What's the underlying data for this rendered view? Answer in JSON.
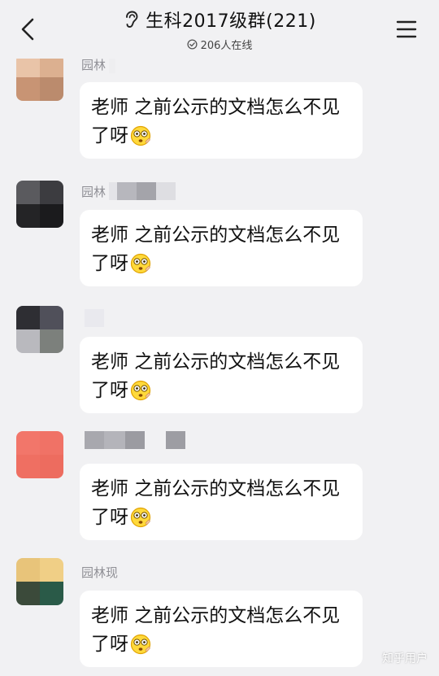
{
  "header": {
    "title": "生科2017级群(221)",
    "online_text": "206人在线",
    "icons": [
      "back-arrow-icon",
      "ear-icon",
      "online-check-icon",
      "menu-icon"
    ]
  },
  "messages": [
    {
      "sender": "园林",
      "text": "老师  之前公示的文档怎么不见了呀",
      "emoji": "flushed-face"
    },
    {
      "sender": "园林",
      "text": "老师  之前公示的文档怎么不见了呀",
      "emoji": "flushed-face"
    },
    {
      "sender": "",
      "text": "老师  之前公示的文档怎么不见了呀",
      "emoji": "flushed-face"
    },
    {
      "sender": "",
      "text": "老师  之前公示的文档怎么不见了呀",
      "emoji": "flushed-face"
    },
    {
      "sender": "园林现",
      "text": "老师  之前公示的文档怎么不见了呀",
      "emoji": "flushed-face"
    }
  ],
  "watermark": "知乎用户",
  "colors": {
    "background": "#f1f1f3",
    "bubble": "#ffffff",
    "sender_name": "#8f8f95"
  }
}
